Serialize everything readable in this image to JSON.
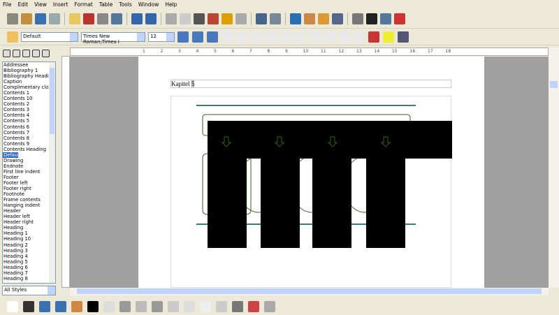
{
  "menu": [
    "File",
    "Edit",
    "View",
    "Insert",
    "Format",
    "Table",
    "Tools",
    "Window",
    "Help"
  ],
  "toolbar_standard": [
    "new-icon",
    "open-icon",
    "save-icon",
    "email-icon",
    "edit-file-icon",
    "export-pdf-icon",
    "print-icon",
    "print-preview-icon",
    "spellcheck-icon",
    "autospellcheck-icon",
    "cut-icon",
    "copy-icon",
    "paste-icon",
    "format-paintbrush-icon",
    "undo-icon",
    "redo-icon",
    "hyperlink-icon",
    "table-icon",
    "show-draw-functions-icon",
    "navigator-icon",
    "stylist-icon",
    "gallery-icon",
    "datasource-icon",
    "nonprinting-chars-icon",
    "zoom-icon",
    "help-icon"
  ],
  "formatting": {
    "style": "Default",
    "font": "Times New Roman;Times I",
    "size": "12",
    "buttons": [
      "bold-icon",
      "italic-icon",
      "underline-icon",
      "align-left-icon",
      "align-center-icon",
      "align-right-icon",
      "justify-icon",
      "ltr-icon",
      "rtl-icon",
      "numbering-icon",
      "bullets-icon",
      "decrease-indent-icon",
      "increase-indent-icon",
      "font-color-icon",
      "highlight-icon",
      "background-color-icon"
    ]
  },
  "stylist": {
    "tabs": [
      "paragraph-styles-icon",
      "character-styles-icon",
      "frame-styles-icon",
      "page-styles-icon",
      "list-styles-icon"
    ],
    "items": [
      "Addressee",
      "Bibliography 1",
      "Bibliography Heading",
      "Caption",
      "Complimentary close",
      "Contents 1",
      "Contents 10",
      "Contents 2",
      "Contents 3",
      "Contents 4",
      "Contents 5",
      "Contents 6",
      "Contents 7",
      "Contents 8",
      "Contents 9",
      "Contents Heading",
      "Default",
      "Drawing",
      "Endnote",
      "First line indent",
      "Footer",
      "Footer left",
      "Footer right",
      "Footnote",
      "Frame contents",
      "Hanging indent",
      "Header",
      "Header left",
      "Header right",
      "Heading",
      "Heading 1",
      "Heading 10",
      "Heading 2",
      "Heading 3",
      "Heading 4",
      "Heading 5",
      "Heading 6",
      "Heading 7",
      "Heading 8"
    ],
    "selected": "Default",
    "filter": "All Styles"
  },
  "ruler_numbers": [
    "1",
    "2",
    "3",
    "4",
    "5",
    "6",
    "7",
    "8",
    "9",
    "10",
    "11",
    "12",
    "13",
    "14",
    "15",
    "16",
    "17",
    "18"
  ],
  "document": {
    "header_label": "Kapitel",
    "header_field": "5"
  },
  "colors": {
    "teal_line": "#3c7a78",
    "green_shape": "#2f5f1a"
  },
  "drawing_toolbar": [
    "select-icon",
    "line-icon",
    "rectangle-icon",
    "ellipse-icon",
    "freeform-icon",
    "text-icon",
    "callout-icon",
    "basic-shapes-icon",
    "symbol-shapes-icon",
    "block-arrows-icon",
    "flowchart-icon",
    "callouts-icon",
    "stars-icon",
    "points-icon",
    "fontwork-icon",
    "from-file-icon",
    "extrusion-icon"
  ]
}
